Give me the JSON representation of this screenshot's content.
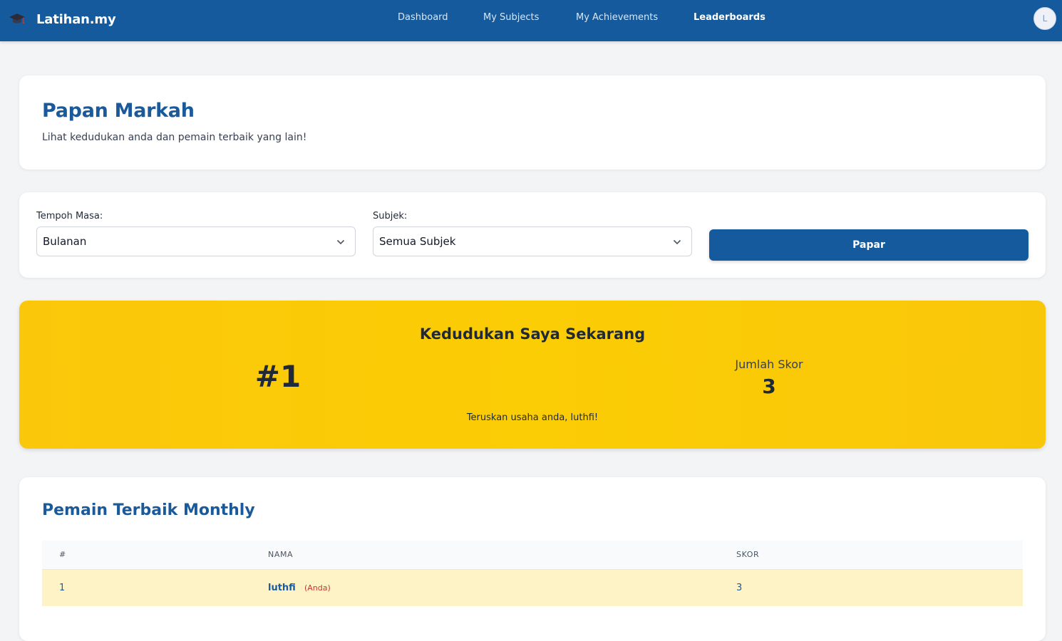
{
  "nav": {
    "brand": "Latihan.my",
    "links": [
      {
        "label": "Dashboard"
      },
      {
        "label": "My Subjects"
      },
      {
        "label": "My Achievements"
      },
      {
        "label": "Leaderboards"
      }
    ],
    "avatar_initial": "L",
    "brand_icon": "graduation-cap-icon"
  },
  "header": {
    "title": "Papan Markah",
    "subtitle": "Lihat kedudukan anda dan pemain terbaik yang lain!"
  },
  "filters": {
    "period_label": "Tempoh Masa:",
    "period_value": "Bulanan",
    "subject_label": "Subjek:",
    "subject_value": "Semua Subjek",
    "submit_label": "Papar"
  },
  "rank": {
    "title": "Kedudukan Saya Sekarang",
    "position": "#1",
    "score_label": "Jumlah Skor",
    "score_value": "3",
    "message": "Teruskan usaha anda, luthfi!"
  },
  "leaderboard": {
    "title": "Pemain Terbaik Monthly",
    "columns": [
      "#",
      "NAMA",
      "SKOR"
    ],
    "rows": [
      {
        "rank": "1",
        "name": "luthfi",
        "tag": "(Anda)",
        "score": "3"
      }
    ]
  },
  "colors": {
    "primary": "#155a9c",
    "highlight": "#fbc70a",
    "row_highlight": "#fef3c7"
  }
}
